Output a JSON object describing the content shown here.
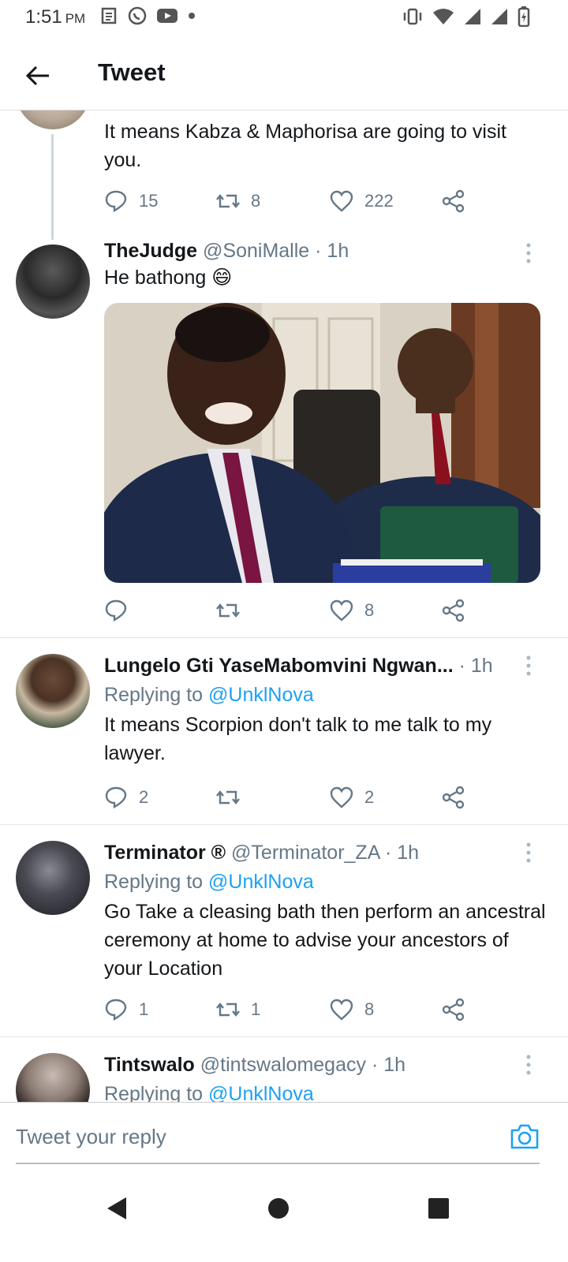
{
  "status_bar": {
    "time": "1:51",
    "ampm": "PM",
    "left_icons": [
      "news-icon",
      "whatsapp-icon",
      "youtube-icon",
      "dot-icon"
    ],
    "right_icons": [
      "vibrate-icon",
      "wifi-icon",
      "signal-icon",
      "signal-icon",
      "battery-icon"
    ]
  },
  "appbar": {
    "title": "Tweet",
    "back_icon": "arrow-left-icon"
  },
  "tweets": [
    {
      "text": "It means Kabza & Maphorisa are going to visit you.",
      "replies": "15",
      "retweets": "8",
      "likes": "222"
    },
    {
      "name": "TheJudge",
      "handle": "@SoniMalle",
      "time": "· 1h",
      "text": "He bathong 😄",
      "replies": "",
      "retweets": "",
      "likes": "8"
    },
    {
      "name": "Lungelo Gti YaseMabomvini Ngwan...",
      "handle": "",
      "time": "· 1h",
      "replying_prefix": "Replying to",
      "replying_to": "@UnklNova",
      "text": "It means Scorpion don't talk to me talk to my lawyer.",
      "replies": "2",
      "retweets": "",
      "likes": "2"
    },
    {
      "name": "Terminator ®",
      "handle": "@Terminator_ZA",
      "time": "· 1h",
      "replying_prefix": "Replying to",
      "replying_to": "@UnklNova",
      "text": "Go Take a cleasing bath then perform an ancestral ceremony at home to advise your ancestors of your Location",
      "replies": "1",
      "retweets": "1",
      "likes": "8"
    },
    {
      "name": "Tintswalo",
      "handle": "@tintswalomegacy",
      "time": "· 1h",
      "replying_prefix": "Replying to",
      "replying_to": "@UnklNova"
    }
  ],
  "compose": {
    "placeholder": "Tweet your reply",
    "camera_icon": "camera-icon"
  },
  "nav": [
    "back-triangle-icon",
    "home-circle-icon",
    "recents-square-icon"
  ],
  "colors": {
    "accent": "#1da1f2",
    "secondary_text": "#657786",
    "primary_text": "#14171a"
  }
}
